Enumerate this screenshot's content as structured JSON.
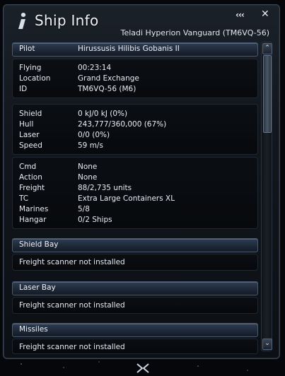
{
  "window": {
    "title": "Ship Info",
    "subtitle": "Teladi Hyperion Vanguard (TM6VQ-56)",
    "collapse_label": "‹‹‹",
    "close_label": "✕"
  },
  "pilot": {
    "label": "Pilot",
    "value": "Hirussusis Hilibis Gobanis II"
  },
  "status": [
    {
      "label": "Flying",
      "value": "00:23:14"
    },
    {
      "label": "Location",
      "value": "Grand Exchange"
    },
    {
      "label": "ID",
      "value": "TM6VQ-56 (M6)"
    }
  ],
  "stats": [
    {
      "label": "Shield",
      "value": "0 kJ/0 kJ (0%)"
    },
    {
      "label": "Hull",
      "value": "243,777/360,000 (67%)"
    },
    {
      "label": "Laser",
      "value": "0/0 (0%)"
    },
    {
      "label": "Speed",
      "value": "59 m/s"
    }
  ],
  "cargo": [
    {
      "label": "Cmd",
      "value": "None"
    },
    {
      "label": "Action",
      "value": "None"
    },
    {
      "label": "Freight",
      "value": "88/2,735 units"
    },
    {
      "label": "TC",
      "value": "Extra Large Containers XL"
    },
    {
      "label": "Marines",
      "value": "5/8"
    },
    {
      "label": "Hangar",
      "value": "0/2 Ships"
    }
  ],
  "sections": [
    {
      "title": "Shield Bay",
      "text": "Freight scanner not installed"
    },
    {
      "title": "Laser Bay",
      "text": "Freight scanner not installed"
    },
    {
      "title": "Missiles",
      "text": "Freight scanner not installed"
    }
  ],
  "scrollbar": {
    "up_label": "⌃",
    "down_label": "⌄"
  },
  "colors": {
    "accent": "#3a4d6a",
    "panel_border": "#1f2731",
    "text": "#e9edf3"
  }
}
